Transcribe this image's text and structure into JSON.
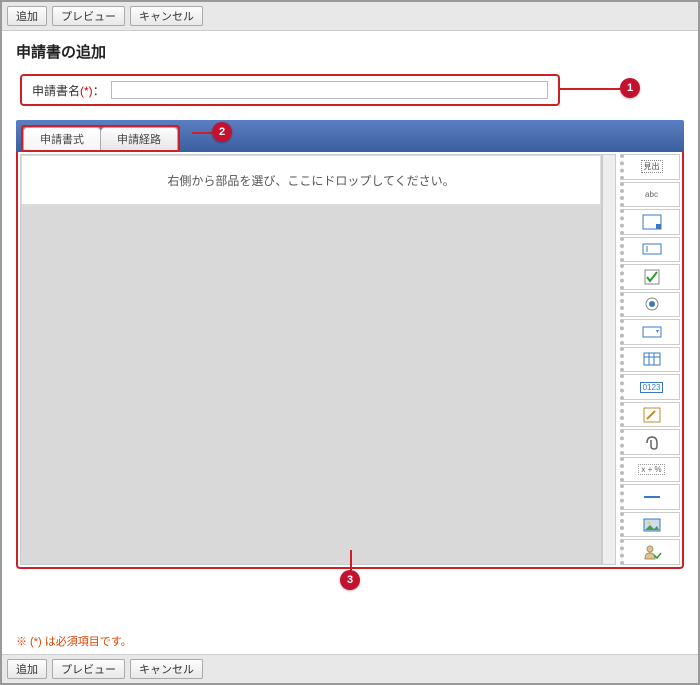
{
  "toolbar": {
    "add": "追加",
    "preview": "プレビュー",
    "cancel": "キャンセル"
  },
  "page": {
    "title": "申請書の追加"
  },
  "form": {
    "name_label": "申請書名",
    "req_mark": "(*)",
    "colon": "：",
    "name_value": ""
  },
  "tabs": {
    "form_tab": "申請書式",
    "route_tab": "申請経路"
  },
  "canvas": {
    "drop_hint": "右側から部品を選び、ここにドロップしてください。"
  },
  "callouts": {
    "c1": "1",
    "c2": "2",
    "c3": "3"
  },
  "footer": {
    "required_note": "※ (*) は必須項目です。"
  },
  "palette": {
    "heading": "見出",
    "label": "abc",
    "numbox": "0123",
    "calc": "x + %"
  }
}
